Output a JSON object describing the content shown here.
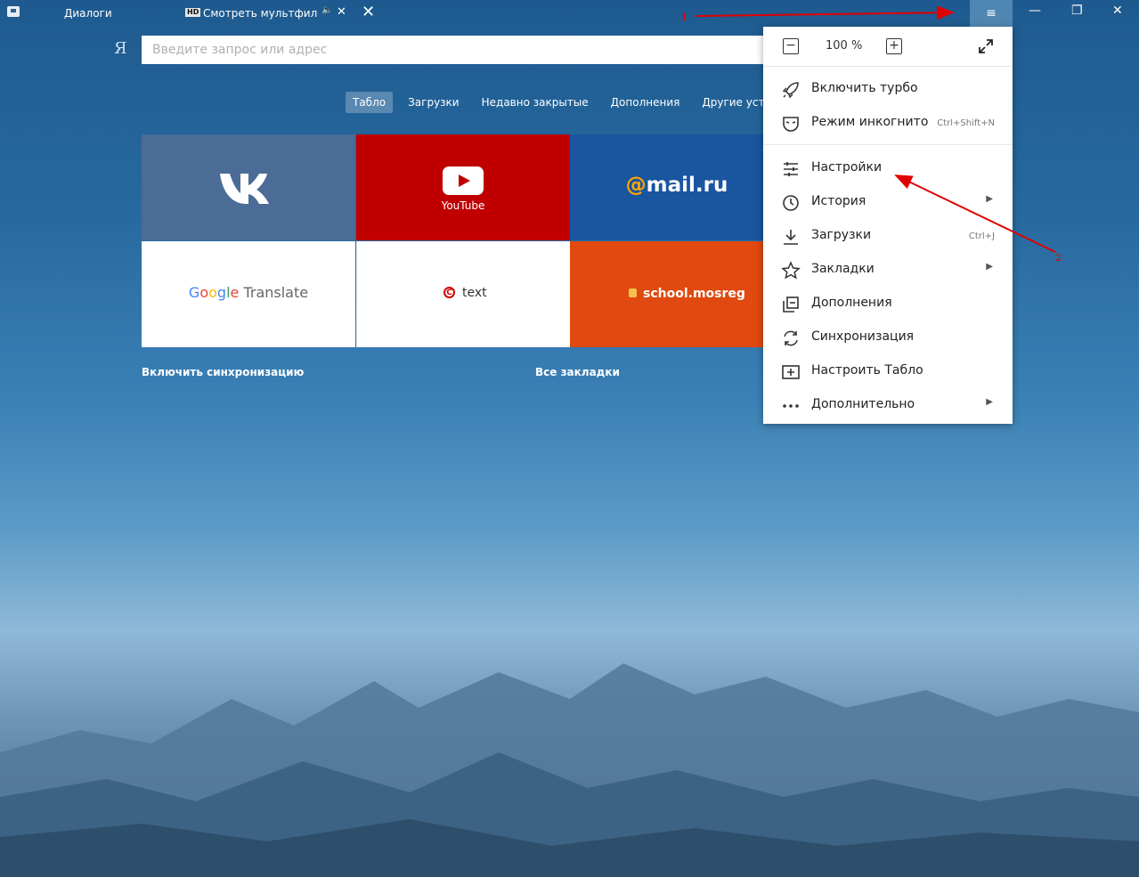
{
  "titlebar": {
    "tab_dialogs": "Диалоги",
    "active_tab_badge": "HD",
    "active_tab_title": "Смотреть мультфильмы",
    "menu_button_glyph": "≡"
  },
  "address": {
    "logo": "Я",
    "placeholder": "Введите запрос или адрес"
  },
  "nav": {
    "items": [
      "Табло",
      "Загрузки",
      "Недавно закрытые",
      "Дополнения",
      "Другие устройства"
    ],
    "active_index": 0
  },
  "tiles": {
    "youtube_label": "YouTube",
    "mail_at": "@",
    "mail_text": "mail.ru",
    "gt_letters": [
      "G",
      "o",
      "o",
      "g",
      "l",
      "e"
    ],
    "gt_suffix": " Translate",
    "text_label": "text",
    "text_icon": "C",
    "school_label": "school.mosreg"
  },
  "links": {
    "sync": "Включить синхронизацию",
    "bookmarks": "Все закладки"
  },
  "menu": {
    "zoom_value": "100 %",
    "items": [
      {
        "label": "Включить турбо",
        "shortcut": "",
        "arrow": false,
        "icon": "rocket-icon"
      },
      {
        "label": "Режим инкогнито",
        "shortcut": "Ctrl+Shift+N",
        "arrow": false,
        "icon": "incognito-mask-icon"
      },
      {
        "label": "Настройки",
        "shortcut": "",
        "arrow": false,
        "icon": "settings-sliders-icon"
      },
      {
        "label": "История",
        "shortcut": "",
        "arrow": true,
        "icon": "clock-icon"
      },
      {
        "label": "Загрузки",
        "shortcut": "Ctrl+J",
        "arrow": false,
        "icon": "download-icon"
      },
      {
        "label": "Закладки",
        "shortcut": "",
        "arrow": true,
        "icon": "star-icon"
      },
      {
        "label": "Дополнения",
        "shortcut": "",
        "arrow": false,
        "icon": "extensions-icon"
      },
      {
        "label": "Синхронизация",
        "shortcut": "",
        "arrow": false,
        "icon": "sync-icon"
      },
      {
        "label": "Настроить Табло",
        "shortcut": "",
        "arrow": false,
        "icon": "customize-tablo-icon"
      },
      {
        "label": "Дополнительно",
        "shortcut": "",
        "arrow": true,
        "icon": "more-dots-icon"
      }
    ]
  },
  "annotations": {
    "label_1": "1",
    "label_2": "2",
    "color": "#e00000"
  },
  "colors": {
    "vk": "#4b6c96",
    "youtube": "#c00000",
    "mail": "#1a55a0",
    "school": "#e0490f",
    "menu_button": "#4f86b2"
  }
}
